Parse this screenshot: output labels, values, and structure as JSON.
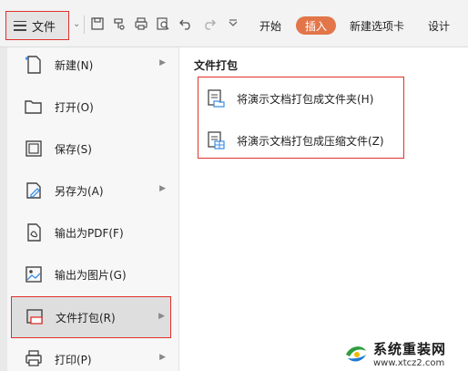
{
  "toolbar": {
    "file_label": "文件",
    "tabs": [
      "开始",
      "插入",
      "新建选项卡",
      "设计"
    ],
    "active_tab": "插入",
    "accent_color": "#e2764a",
    "highlight_color": "#e0312b",
    "quick_access_icons": [
      "save-icon",
      "format-painter-icon",
      "print-icon",
      "print-preview-icon",
      "undo-icon",
      "redo-icon",
      "more-dropdown-icon"
    ]
  },
  "menu": {
    "items": [
      {
        "label": "新建(N)",
        "icon": "new-doc-icon",
        "has_submenu": true
      },
      {
        "label": "打开(O)",
        "icon": "folder-open-icon",
        "has_submenu": false
      },
      {
        "label": "保存(S)",
        "icon": "save-icon",
        "has_submenu": false
      },
      {
        "label": "另存为(A)",
        "icon": "save-as-icon",
        "has_submenu": true
      },
      {
        "label": "输出为PDF(F)",
        "icon": "export-pdf-icon",
        "has_submenu": false
      },
      {
        "label": "输出为图片(G)",
        "icon": "export-image-icon",
        "has_submenu": false
      },
      {
        "label": "文件打包(R)",
        "icon": "package-icon",
        "has_submenu": true,
        "selected": true
      },
      {
        "label": "打印(P)",
        "icon": "print-icon",
        "has_submenu": true
      }
    ]
  },
  "panel": {
    "title": "文件打包",
    "items": [
      {
        "label": "将演示文档打包成文件夹(H)",
        "icon": "package-folder-icon"
      },
      {
        "label": "将演示文档打包成压缩文件(Z)",
        "icon": "package-zip-icon"
      }
    ]
  },
  "watermark": {
    "title": "系统重装网",
    "url": "www.xtcz2.com"
  }
}
